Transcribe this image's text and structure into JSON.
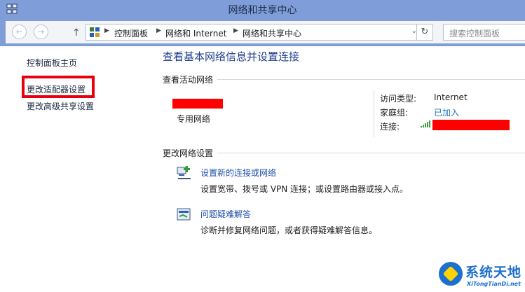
{
  "window": {
    "title": "网络和共享中心",
    "accent": "#7f9ed9"
  },
  "toolbar": {
    "back_icon": "arrow-left",
    "forward_icon": "arrow-right",
    "up_icon": "arrow-up",
    "refresh_icon": "refresh",
    "breadcrumbs": [
      "控制面板",
      "网络和 Internet",
      "网络和共享中心"
    ],
    "search_placeholder": "搜索控制面板"
  },
  "sidebar": {
    "items": [
      {
        "label": "控制面板主页"
      },
      {
        "label": "更改适配器设置",
        "highlight_color": "#e8000f"
      },
      {
        "label": "更改高级共享设置"
      }
    ]
  },
  "main": {
    "title": "查看基本网络信息并设置连接",
    "active_section": "查看活动网络",
    "network_type": "专用网络",
    "access_type_label": "访问类型:",
    "access_type_value": "Internet",
    "homegroup_label": "家庭组:",
    "homegroup_value": "已加入",
    "connection_label": "连接:",
    "change_section": "更改网络设置",
    "tasks": [
      {
        "link": "设置新的连接或网络",
        "desc": "设置宽带、拨号或 VPN 连接；或设置路由器或接入点。",
        "icon": "new-connection-icon"
      },
      {
        "link": "问题疑难解答",
        "desc": "诊断并修复网络问题，或者获得疑难解答信息。",
        "icon": "troubleshoot-icon"
      }
    ]
  },
  "watermark": {
    "cn": "系统天地",
    "en": "XiTongTianDi.net"
  }
}
